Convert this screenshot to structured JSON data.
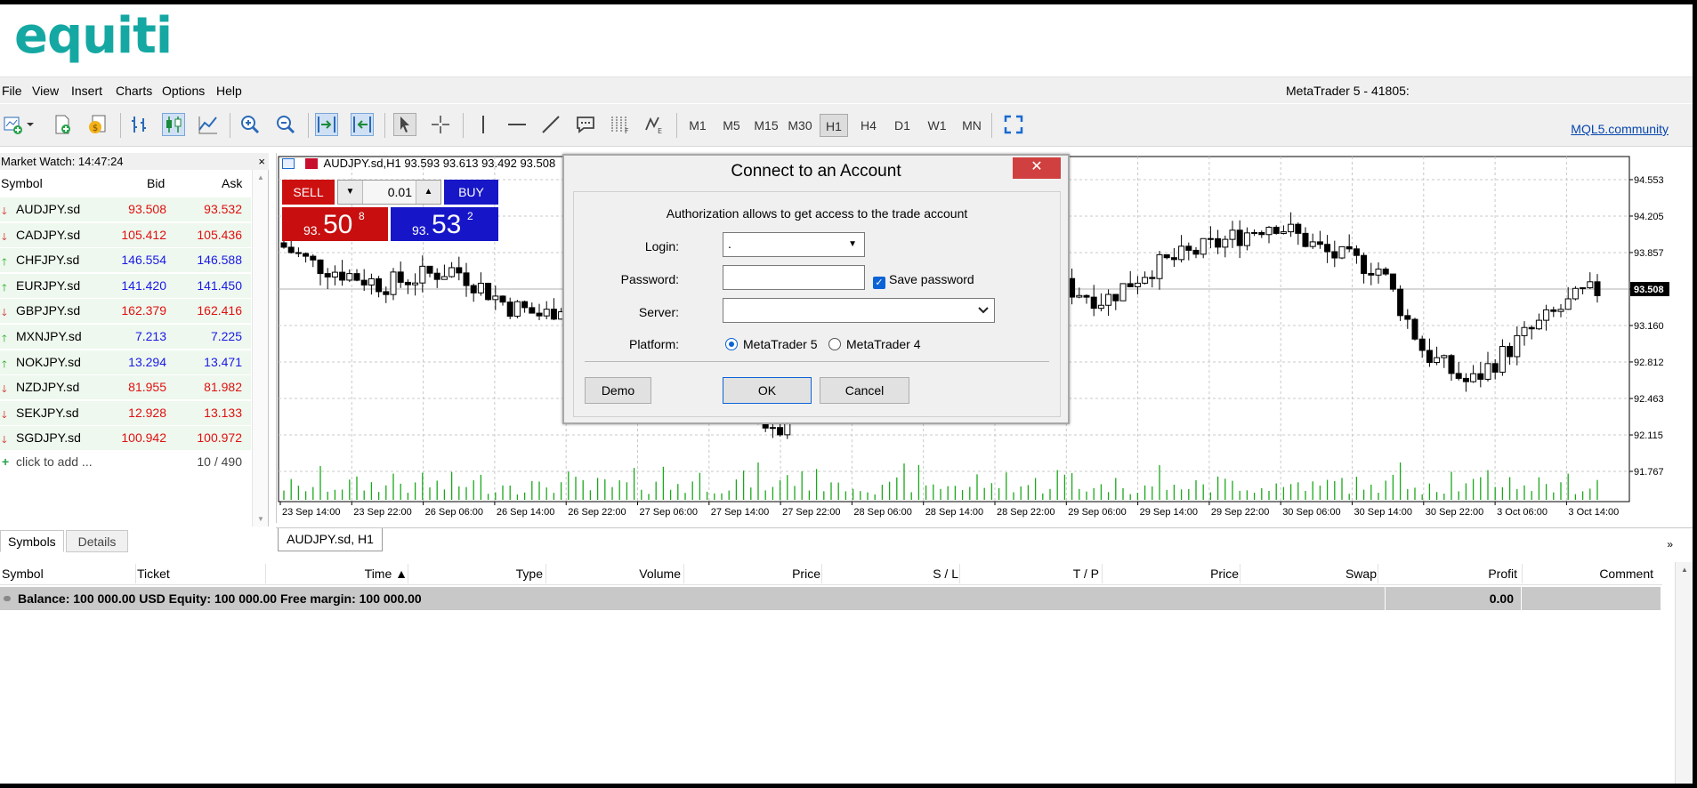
{
  "brand": {
    "logo_text": "equiti"
  },
  "menu": [
    "File",
    "View",
    "Insert",
    "Charts",
    "Options",
    "Help"
  ],
  "app_title": "MetaTrader 5 - 41805:",
  "toolbar": {
    "timeframes": [
      "M1",
      "M5",
      "M15",
      "M30",
      "H1",
      "H4",
      "D1",
      "W1",
      "MN"
    ],
    "active_timeframe": "H1",
    "community_link": "MQL5.community"
  },
  "market_watch": {
    "title": "Market Watch: 14:47:24",
    "close": "×",
    "columns": {
      "symbol": "Symbol",
      "bid": "Bid",
      "ask": "Ask"
    },
    "rows": [
      {
        "dir": "down",
        "symbol": "AUDJPY.sd",
        "bid": "93.508",
        "ask": "93.532"
      },
      {
        "dir": "down",
        "symbol": "CADJPY.sd",
        "bid": "105.412",
        "ask": "105.436"
      },
      {
        "dir": "up",
        "symbol": "CHFJPY.sd",
        "bid": "146.554",
        "ask": "146.588"
      },
      {
        "dir": "up",
        "symbol": "EURJPY.sd",
        "bid": "141.420",
        "ask": "141.450"
      },
      {
        "dir": "down",
        "symbol": "GBPJPY.sd",
        "bid": "162.379",
        "ask": "162.416"
      },
      {
        "dir": "up",
        "symbol": "MXNJPY.sd",
        "bid": "7.213",
        "ask": "7.225"
      },
      {
        "dir": "up",
        "symbol": "NOKJPY.sd",
        "bid": "13.294",
        "ask": "13.471"
      },
      {
        "dir": "down",
        "symbol": "NZDJPY.sd",
        "bid": "81.955",
        "ask": "81.982"
      },
      {
        "dir": "down",
        "symbol": "SEKJPY.sd",
        "bid": "12.928",
        "ask": "13.133"
      },
      {
        "dir": "down",
        "symbol": "SGDJPY.sd",
        "bid": "100.942",
        "ask": "100.972"
      }
    ],
    "add_label": "click to add ...",
    "count": "10 / 490",
    "tabs": [
      "Symbols",
      "Details"
    ]
  },
  "chart": {
    "header": "AUDJPY.sd,H1  93.593 93.613 93.492 93.508",
    "tab_label": "AUDJPY.sd, H1",
    "current_price": "93.508",
    "price_labels": [
      "94.553",
      "94.205",
      "93.857",
      "93.508",
      "93.160",
      "92.812",
      "92.463",
      "92.115",
      "91.767"
    ],
    "time_labels": [
      "23 Sep 14:00",
      "23 Sep 22:00",
      "26 Sep 06:00",
      "26 Sep 14:00",
      "26 Sep 22:00",
      "27 Sep 06:00",
      "27 Sep 14:00",
      "27 Sep 22:00",
      "28 Sep 06:00",
      "28 Sep 14:00",
      "28 Sep 22:00",
      "29 Sep 06:00",
      "29 Sep 14:00",
      "29 Sep 22:00",
      "30 Sep 06:00",
      "30 Sep 14:00",
      "30 Sep 22:00",
      "3 Oct 06:00",
      "3 Oct 14:00"
    ]
  },
  "trade_panel": {
    "sell": "SELL",
    "buy": "BUY",
    "volume": "0.01",
    "sell_price": {
      "prefix": "93.",
      "big": "50",
      "sup": "8"
    },
    "buy_price": {
      "prefix": "93.",
      "big": "53",
      "sup": "2"
    }
  },
  "dialog": {
    "title": "Connect to an Account",
    "close": "✕",
    "info": "Authorization allows to get access to the trade account",
    "login_label": "Login:",
    "login_value": ".",
    "password_label": "Password:",
    "password_value": "",
    "save_password": "Save password",
    "server_label": "Server:",
    "server_value": "",
    "platform_label": "Platform:",
    "platform_options": [
      "MetaTrader 5",
      "MetaTrader 4"
    ],
    "selected_platform": "MetaTrader 5",
    "buttons": {
      "demo": "Demo",
      "ok": "OK",
      "cancel": "Cancel"
    }
  },
  "toolbox": {
    "columns": [
      "Symbol",
      "Ticket",
      "Time ▲",
      "Type",
      "Volume",
      "Price",
      "S / L",
      "T / P",
      "Price",
      "Swap",
      "Profit",
      "Comment"
    ],
    "balance_text": "Balance: 100 000.00 USD  Equity: 100 000.00  Free margin: 100 000.00",
    "profit": "0.00"
  },
  "colors": {
    "brand": "#15a8a3",
    "sell": "#cc1010",
    "buy": "#1717c8",
    "bullish_volume": "#1aa81a",
    "close_button": "#d04040"
  },
  "icons": [
    "new-chart-icon",
    "new-order-icon",
    "zoom-in-icon",
    "zoom-out-icon",
    "cursor-icon",
    "crosshair-icon",
    "fullscreen-icon"
  ]
}
